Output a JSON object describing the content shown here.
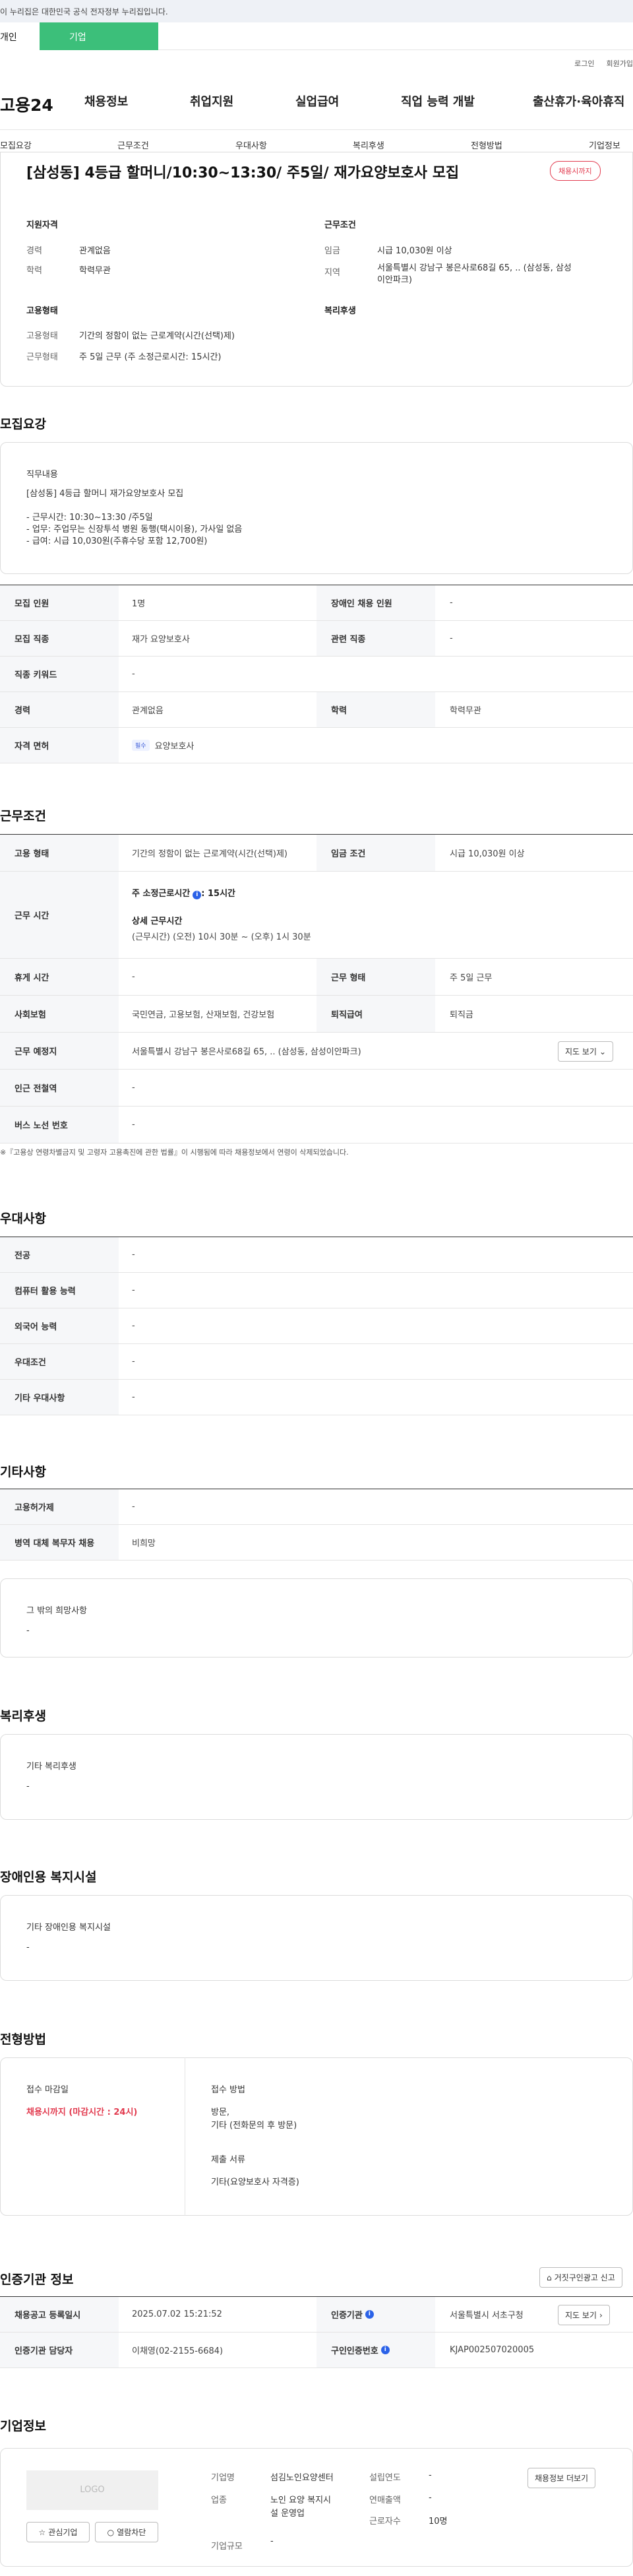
{
  "notice": "이 누리집은 대한민국 공식 전자정부 누리집입니다.",
  "usertabs": {
    "individual": "개인",
    "corporate": "기업"
  },
  "utility": {
    "login": "로그인",
    "join": "회원가입"
  },
  "logo": "고용24",
  "gnb": [
    "채용정보",
    "취업지원",
    "실업급여",
    "직업 능력 개발",
    "출산휴가·육아휴직"
  ],
  "subnav": [
    "모집요강",
    "근무조건",
    "우대사항",
    "복리후생",
    "전형방법",
    "기업정보"
  ],
  "job": {
    "title": "[삼성동] 4등급 할머니/10:30~13:30/ 주5일/ 재가요양보호사 모집",
    "status": "채용시까지",
    "qual_heading": "지원자격",
    "cond_heading": "근무조건",
    "emp_heading": "고용형태",
    "welfare_heading": "복리후생",
    "career_label": "경력",
    "career": "관계없음",
    "edu_label": "학력",
    "edu": "학력무관",
    "wage_label": "임금",
    "wage": "시급 10,030원 이상",
    "region_label": "지역",
    "region_line1": "서울특별시 강남구 봉은사로68길 65, .. (삼성동, 삼성",
    "region_line2": "이안파크)",
    "emptype_label": "고용형태",
    "emptype": "기간의 정함이 없는 근로계약(시간(선택)제)",
    "worktype_label": "근무형태",
    "worktype": "주 5일 근무 (주 소정근로시간: 15시간)"
  },
  "recruit": {
    "section": "모집요강",
    "desc_title": "직무내용",
    "desc_lines": [
      "[삼성동] 4등급 할머니 재가요양보호사 모집",
      "",
      "- 근무시간: 10:30~13:30 /주5일",
      "- 업무:  주업무는 신장투석 병원 동행(택시이용), 가사일 없음",
      "- 급여: 시급 10,030원(주휴수당 포함 12,700원)"
    ],
    "rows": {
      "headcount_label": "모집 인원",
      "headcount": "1명",
      "disabled_label": "장애인 채용 인원",
      "disabled": "-",
      "job_label": "모집 직종",
      "job": "재가 요양보호사",
      "related_label": "관련 직종",
      "related": "-",
      "keyword_label": "직종 키워드",
      "keyword": "-",
      "career_label": "경력",
      "career": "관계없음",
      "edu_label": "학력",
      "edu": "학력무관",
      "license_label": "자격 면허",
      "license_tag": "필수",
      "license": "요양보호사"
    }
  },
  "conditions": {
    "section": "근무조건",
    "emptype_label": "고용 형태",
    "emptype": "기간의 정함이 없는 근로계약(시간(선택)제)",
    "wage_label": "임금 조건",
    "wage": "시급 10,030원 이상",
    "hours_label": "근무 시간",
    "weekly_label": "주 소정근로시간",
    "weekly_value": ": 15시간",
    "detail_label": "상세 근무시간",
    "detail_value": "(근무시간) (오전) 10시 30분 ~ (오후) 1시 30분",
    "break_label": "휴게 시간",
    "break": "-",
    "form_label": "근무 형태",
    "form": "주 5일 근무",
    "insurance_label": "사회보험",
    "insurance": "국민연금, 고용보험, 산재보험, 건강보험",
    "retire_label": "퇴직급여",
    "retire": "퇴직금",
    "place_label": "근무 예정지",
    "place": "서울특별시 강남구 봉은사로68길 65, .. (삼성동, 삼성이안파크)",
    "map_btn": "지도 보기",
    "subway_label": "인근 전철역",
    "subway": "-",
    "bus_label": "버스 노선 번호",
    "bus": "-",
    "note": "※『고용상 연령차별금지 및 고령자 고용촉진에 관한 법률』이 시행됨에 따라 채용정보에서 연령이 삭제되었습니다."
  },
  "preference": {
    "section": "우대사항",
    "rows": [
      {
        "label": "전공",
        "value": "-"
      },
      {
        "label": "컴퓨터 활용 능력",
        "value": "-"
      },
      {
        "label": "외국어 능력",
        "value": "-"
      },
      {
        "label": "우대조건",
        "value": "-"
      },
      {
        "label": "기타 우대사항",
        "value": "-"
      }
    ]
  },
  "etc": {
    "section": "기타사항",
    "rows": [
      {
        "label": "고용허가제",
        "value": "-"
      },
      {
        "label": "병역 대체 복무자 채용",
        "value": "비희망"
      }
    ],
    "other_title": "그 밖의 희망사항",
    "other_value": "-"
  },
  "welfare": {
    "section": "복리후생",
    "title": "기타 복리후생",
    "value": "-"
  },
  "disability": {
    "section": "장애인용 복지시설",
    "title": "기타 장애인용 복지시설",
    "value": "-"
  },
  "screening": {
    "section": "전형방법",
    "deadline_title": "접수 마감일",
    "deadline_value": "채용시까지 (마감시간 : 24시)",
    "method_title": "접수 방법",
    "method_line1": "방문,",
    "method_line2": "기타 (전화문의 후 방문)",
    "docs_title": "제출 서류",
    "docs_value": "기타(요양보호사 자격증)"
  },
  "agency": {
    "section": "인증기관 정보",
    "report_btn": "거짓구인광고 신고",
    "reg_label": "채용공고 등록일시",
    "reg": "2025.07.02 15:21:52",
    "org_label": "인증기관",
    "org": "서울특별시 서초구청",
    "map_btn": "지도 보기",
    "manager_label": "인증기관 담당자",
    "manager": "이채영(02-2155-6684)",
    "num_label": "구인인증번호",
    "num": "KJAP002507020005"
  },
  "company": {
    "section": "기업정보",
    "logo": "LOGO",
    "fav_btn": "관심기업",
    "block_btn": "열람차단",
    "info_btn": "채용정보 더보기",
    "name_label": "기업명",
    "name": "섬김노인요양센터",
    "industry_label": "업종",
    "industry_line1": "노인 요양 복지시",
    "industry_line2": "설 운영업",
    "size_label": "기업규모",
    "size": "-",
    "founded_label": "설립연도",
    "founded": "-",
    "revenue_label": "연매출액",
    "revenue": "-",
    "employees_label": "근로자수",
    "employees": "10명"
  }
}
